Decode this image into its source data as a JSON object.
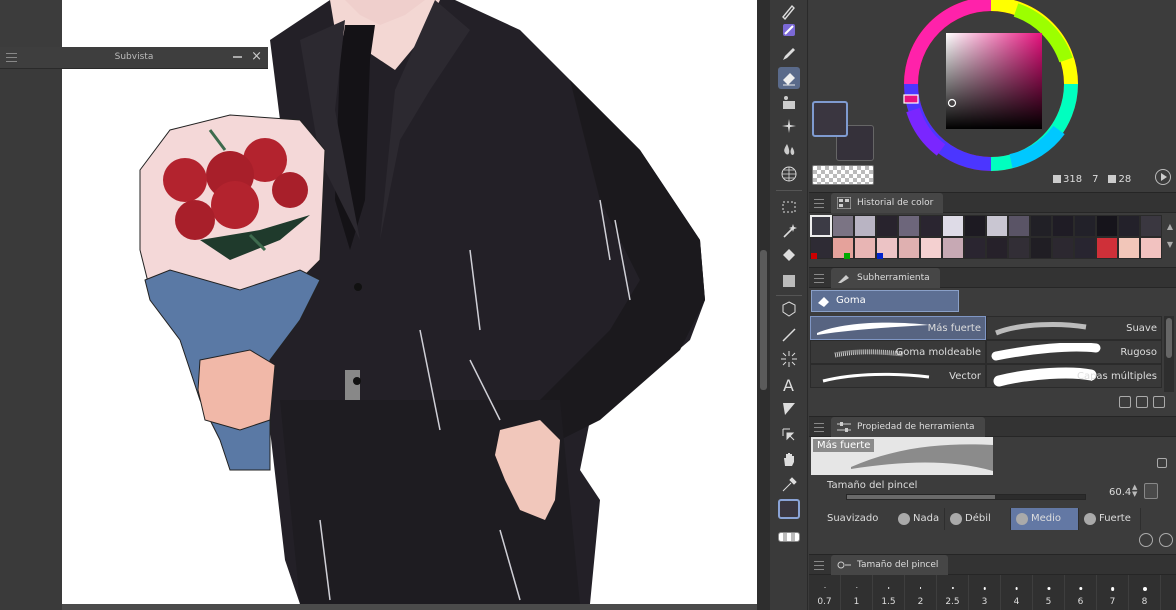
{
  "subview": {
    "title": "Subvista",
    "close": "×"
  },
  "color_wheel": {
    "main_color": "#3a3640",
    "sub_color": "#35313a",
    "hue_indicator": "#e7127e",
    "readout": {
      "h": "318",
      "s": "7",
      "v": "28"
    }
  },
  "color_history": {
    "title": "Historial de color",
    "swatches": [
      "#3c3b45",
      "#7b7484",
      "#b9b4c3",
      "#28232d",
      "#6d667b",
      "#2a2530",
      "#dedbe7",
      "#1d1a22",
      "#c9c6d2",
      "#5a5466",
      "#212026",
      "#1f1c25",
      "#222129",
      "#16141b",
      "#23212a",
      "#3a3740",
      "#2e2b34",
      "#e5a29b",
      "#e8b5b4",
      "#ecc3c5",
      "#dfb0b0",
      "#f4d0d0",
      "#c7a9b4",
      "#2a2530",
      "#26212a",
      "#322e36",
      "#201e24",
      "#2c2830",
      "#282530",
      "#cf3039",
      "#f2c6b9",
      "#f2c2c0"
    ],
    "indicator_colors": [
      "#cc0000",
      "#00aa00",
      "#0022cc"
    ]
  },
  "subtool": {
    "title": "Subherramienta",
    "group": "Goma",
    "items": [
      {
        "label": "Más fuerte"
      },
      {
        "label": "Suave"
      },
      {
        "label": "Goma moldeable"
      },
      {
        "label": "Rugoso"
      },
      {
        "label": "Vector"
      },
      {
        "label": "Capas múltiples"
      }
    ]
  },
  "tool_property": {
    "title": "Propiedad de herramienta",
    "preview_label": "Más fuerte",
    "brush_size_label": "Tamaño del pincel",
    "brush_size_value": "60.4",
    "brush_size_fraction": 0.62,
    "smoothing_label": "Suavizado",
    "smoothing_options": [
      "Nada",
      "Débil",
      "Medio",
      "Fuerte"
    ],
    "smoothing_selected": "Medio"
  },
  "brush_size": {
    "title": "Tamaño del pincel",
    "sizes": [
      "0.7",
      "1",
      "1.5",
      "2",
      "2.5",
      "3",
      "4",
      "5",
      "6",
      "7",
      "8"
    ]
  }
}
